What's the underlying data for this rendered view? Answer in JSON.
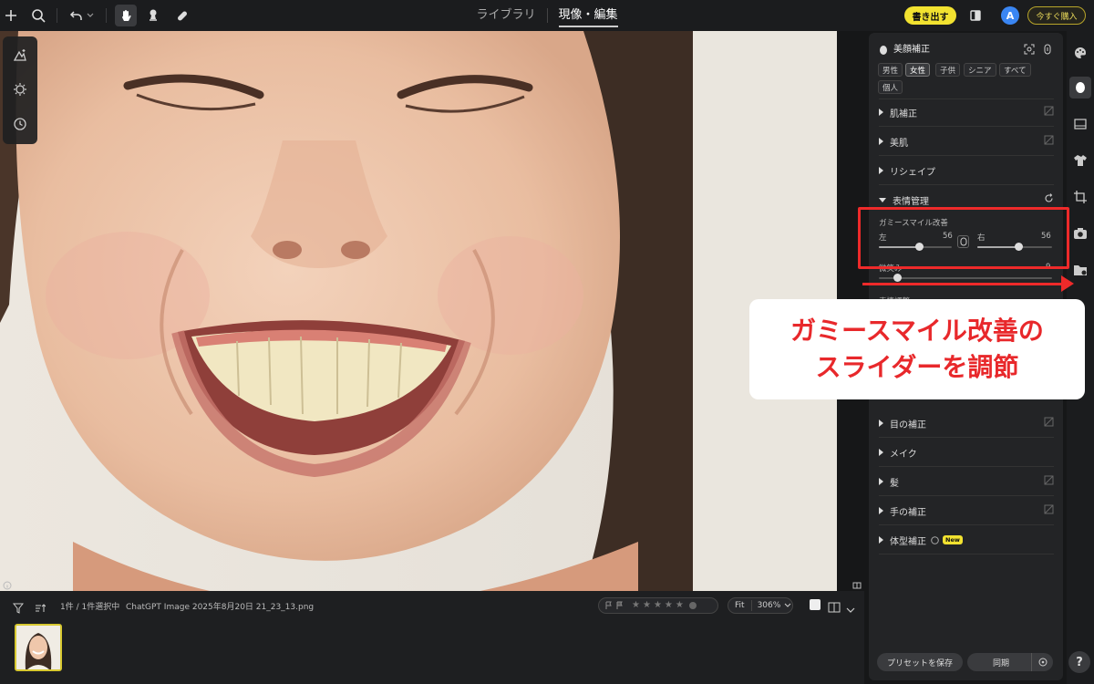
{
  "topbar": {
    "tabs": [
      {
        "label": "ライブラリ"
      },
      {
        "label": "現像・編集"
      }
    ],
    "export_label": "書き出す",
    "avatar_letter": "A",
    "buy_label": "今すぐ購入"
  },
  "bottom": {
    "selection": "1件 / 1件選択中",
    "filename": "ChatGPT Image 2025年8月20日 21_23_13.png",
    "fit_label": "Fit",
    "zoom": "306%",
    "rating_stars": 5
  },
  "panel": {
    "title": "美顔補正",
    "chips": [
      "男性",
      "女性",
      "子供",
      "シニア",
      "すべて",
      "個人"
    ],
    "selected_chip": "女性",
    "sections": [
      {
        "label": "肌補正"
      },
      {
        "label": "美肌"
      },
      {
        "label": "リシェイプ"
      },
      {
        "label": "表情管理"
      },
      {
        "label": "目の補正"
      },
      {
        "label": "メイク"
      },
      {
        "label": "髪"
      },
      {
        "label": "手の補正"
      },
      {
        "label": "体型補正"
      }
    ],
    "new_badge": "New",
    "gummy": {
      "label": "ガミースマイル改善",
      "left_label": "左",
      "left_value": "56",
      "right_label": "右",
      "right_value": "56",
      "left_fraction": 0.56,
      "right_fraction": 0.56
    },
    "partial_label": "微笑み",
    "partial_value": "9",
    "partial_label2": "表情調整",
    "save_preset": "プリセットを保存",
    "sync": "同期"
  },
  "callout": {
    "line1": "ガミースマイル改善の",
    "line2": "スライダーを調節"
  },
  "help": "?",
  "colors": {
    "accent": "#f2e230",
    "annotation": "#ee2a2a",
    "panel": "#232426"
  }
}
